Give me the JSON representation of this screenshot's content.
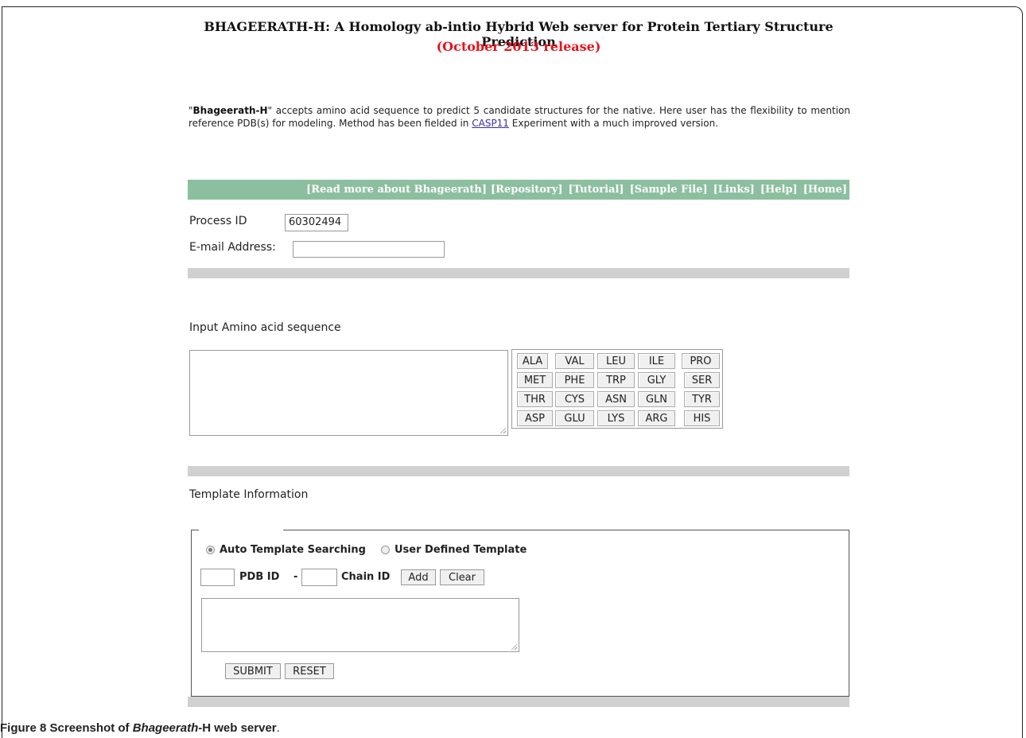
{
  "header": {
    "title": "BHAGEERATH-H: A Homology ab-intio Hybrid Web server for Protein Tertiary Structure Prediction",
    "release": "(October 2013 release)"
  },
  "intro": {
    "open_quote": "\"",
    "name": "Bhageerath-H",
    "text_before_link": "\" accepts amino acid sequence to predict 5 candidate structures for the native. Here user has the flexibility to mention reference PDB(s) for modeling. Method has been fielded in ",
    "link": "CASP11",
    "text_after_link": " Experiment with a much improved version."
  },
  "nav": {
    "items": [
      "[Read more about Bhageerath]",
      "[Repository]",
      "[Tutorial]",
      "[Sample File]",
      "[Links]",
      "[Help]",
      "[Home]"
    ]
  },
  "form": {
    "process_id_label": "Process ID",
    "process_id_value": "60302494",
    "email_label": "E-mail Address:",
    "email_value": "",
    "sequence_label": "Input Amino acid sequence",
    "sequence_value": "",
    "template_label": "Template Information",
    "auto_template_label": "Auto Template Searching",
    "user_template_label": "User Defined Template",
    "pdb_id_label": "PDB ID",
    "dash": "-",
    "chain_id_label": "Chain ID",
    "add_label": "Add",
    "clear_label": "Clear",
    "submit_label": "SUBMIT",
    "reset_label": "RESET",
    "template_selected": "auto"
  },
  "amino_acids": [
    [
      "ALA",
      "VAL",
      "LEU",
      "ILE",
      "PRO"
    ],
    [
      "MET",
      "PHE",
      "TRP",
      "GLY",
      "SER"
    ],
    [
      "THR",
      "CYS",
      "ASN",
      "GLN",
      "TYR"
    ],
    [
      "ASP",
      "GLU",
      "LYS",
      "ARG",
      "HIS"
    ]
  ],
  "caption": {
    "figure": "Figure 8",
    "text_a": " Screenshot of ",
    "italic": "Bhageerath",
    "text_b": "-H web server",
    "period": "."
  }
}
